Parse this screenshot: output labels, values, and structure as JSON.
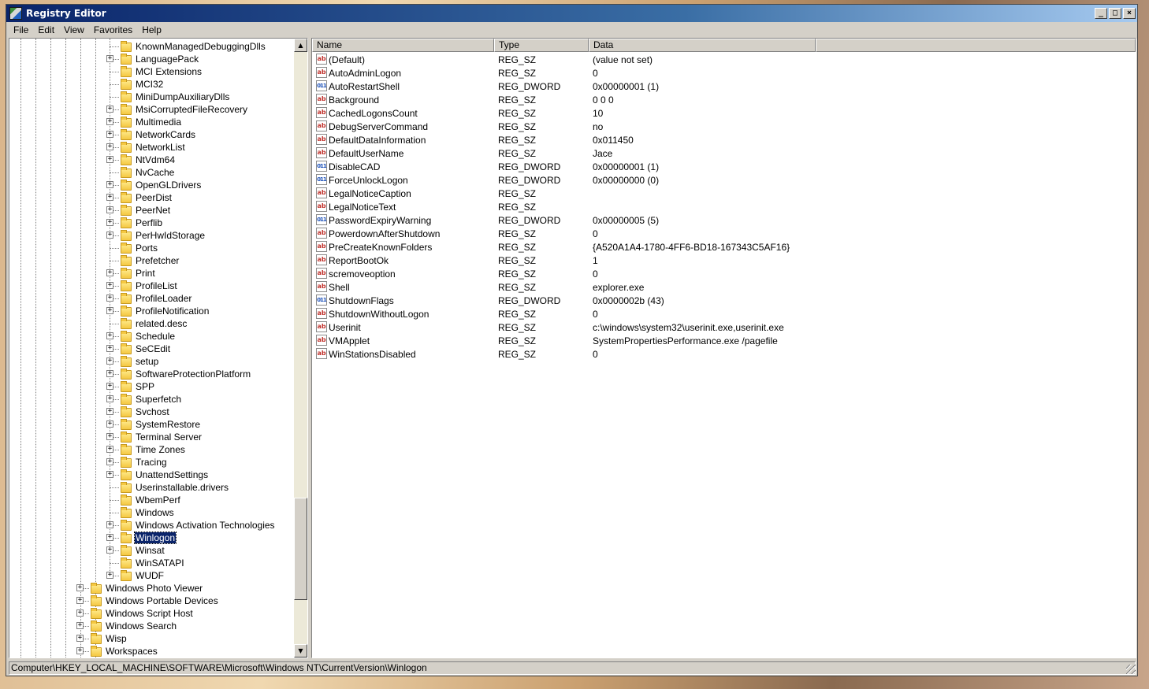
{
  "window": {
    "title": "Registry Editor",
    "controls": [
      "_",
      "□",
      "×"
    ]
  },
  "menu": [
    "File",
    "Edit",
    "View",
    "Favorites",
    "Help"
  ],
  "tree": {
    "nested_items": [
      {
        "label": "KnownManagedDebuggingDlls",
        "expandable": false
      },
      {
        "label": "LanguagePack",
        "expandable": true
      },
      {
        "label": "MCI Extensions",
        "expandable": false
      },
      {
        "label": "MCI32",
        "expandable": false
      },
      {
        "label": "MiniDumpAuxiliaryDlls",
        "expandable": false
      },
      {
        "label": "MsiCorruptedFileRecovery",
        "expandable": true
      },
      {
        "label": "Multimedia",
        "expandable": true
      },
      {
        "label": "NetworkCards",
        "expandable": true
      },
      {
        "label": "NetworkList",
        "expandable": true
      },
      {
        "label": "NtVdm64",
        "expandable": true
      },
      {
        "label": "NvCache",
        "expandable": false
      },
      {
        "label": "OpenGLDrivers",
        "expandable": true
      },
      {
        "label": "PeerDist",
        "expandable": true
      },
      {
        "label": "PeerNet",
        "expandable": true
      },
      {
        "label": "Perflib",
        "expandable": true
      },
      {
        "label": "PerHwIdStorage",
        "expandable": true
      },
      {
        "label": "Ports",
        "expandable": false
      },
      {
        "label": "Prefetcher",
        "expandable": false
      },
      {
        "label": "Print",
        "expandable": true
      },
      {
        "label": "ProfileList",
        "expandable": true
      },
      {
        "label": "ProfileLoader",
        "expandable": true
      },
      {
        "label": "ProfileNotification",
        "expandable": true
      },
      {
        "label": "related.desc",
        "expandable": false
      },
      {
        "label": "Schedule",
        "expandable": true
      },
      {
        "label": "SeCEdit",
        "expandable": true
      },
      {
        "label": "setup",
        "expandable": true
      },
      {
        "label": "SoftwareProtectionPlatform",
        "expandable": true
      },
      {
        "label": "SPP",
        "expandable": true
      },
      {
        "label": "Superfetch",
        "expandable": true
      },
      {
        "label": "Svchost",
        "expandable": true
      },
      {
        "label": "SystemRestore",
        "expandable": true
      },
      {
        "label": "Terminal Server",
        "expandable": true
      },
      {
        "label": "Time Zones",
        "expandable": true
      },
      {
        "label": "Tracing",
        "expandable": true
      },
      {
        "label": "UnattendSettings",
        "expandable": true
      },
      {
        "label": "Userinstallable.drivers",
        "expandable": false
      },
      {
        "label": "WbemPerf",
        "expandable": false
      },
      {
        "label": "Windows",
        "expandable": false
      },
      {
        "label": "Windows Activation Technologies",
        "expandable": true
      },
      {
        "label": "Winlogon",
        "expandable": true,
        "selected": true
      },
      {
        "label": "Winsat",
        "expandable": true
      },
      {
        "label": "WinSATAPI",
        "expandable": false
      },
      {
        "label": "WUDF",
        "expandable": true
      }
    ],
    "parent_items": [
      {
        "label": "Windows Photo Viewer",
        "expandable": true
      },
      {
        "label": "Windows Portable Devices",
        "expandable": true
      },
      {
        "label": "Windows Script Host",
        "expandable": true
      },
      {
        "label": "Windows Search",
        "expandable": true
      },
      {
        "label": "Wisp",
        "expandable": true
      },
      {
        "label": "Workspaces",
        "expandable": true
      }
    ]
  },
  "list": {
    "columns": [
      "Name",
      "Type",
      "Data"
    ],
    "rows": [
      {
        "icon": "string-value-icon",
        "name": "(Default)",
        "type": "REG_SZ",
        "data": "(value not set)"
      },
      {
        "icon": "string-value-icon",
        "name": "AutoAdminLogon",
        "type": "REG_SZ",
        "data": "0"
      },
      {
        "icon": "dword-value-icon",
        "name": "AutoRestartShell",
        "type": "REG_DWORD",
        "data": "0x00000001 (1)"
      },
      {
        "icon": "string-value-icon",
        "name": "Background",
        "type": "REG_SZ",
        "data": "0 0 0"
      },
      {
        "icon": "string-value-icon",
        "name": "CachedLogonsCount",
        "type": "REG_SZ",
        "data": "10"
      },
      {
        "icon": "string-value-icon",
        "name": "DebugServerCommand",
        "type": "REG_SZ",
        "data": "no"
      },
      {
        "icon": "string-value-icon",
        "name": "DefaultDataInformation",
        "type": "REG_SZ",
        "data": "0x011450"
      },
      {
        "icon": "string-value-icon",
        "name": "DefaultUserName",
        "type": "REG_SZ",
        "data": "Jace"
      },
      {
        "icon": "dword-value-icon",
        "name": "DisableCAD",
        "type": "REG_DWORD",
        "data": "0x00000001 (1)"
      },
      {
        "icon": "dword-value-icon",
        "name": "ForceUnlockLogon",
        "type": "REG_DWORD",
        "data": "0x00000000 (0)"
      },
      {
        "icon": "string-value-icon",
        "name": "LegalNoticeCaption",
        "type": "REG_SZ",
        "data": ""
      },
      {
        "icon": "string-value-icon",
        "name": "LegalNoticeText",
        "type": "REG_SZ",
        "data": ""
      },
      {
        "icon": "dword-value-icon",
        "name": "PasswordExpiryWarning",
        "type": "REG_DWORD",
        "data": "0x00000005 (5)"
      },
      {
        "icon": "string-value-icon",
        "name": "PowerdownAfterShutdown",
        "type": "REG_SZ",
        "data": "0"
      },
      {
        "icon": "string-value-icon",
        "name": "PreCreateKnownFolders",
        "type": "REG_SZ",
        "data": "{A520A1A4-1780-4FF6-BD18-167343C5AF16}"
      },
      {
        "icon": "string-value-icon",
        "name": "ReportBootOk",
        "type": "REG_SZ",
        "data": "1"
      },
      {
        "icon": "string-value-icon",
        "name": "scremoveoption",
        "type": "REG_SZ",
        "data": "0"
      },
      {
        "icon": "string-value-icon",
        "name": "Shell",
        "type": "REG_SZ",
        "data": "explorer.exe"
      },
      {
        "icon": "dword-value-icon",
        "name": "ShutdownFlags",
        "type": "REG_DWORD",
        "data": "0x0000002b (43)"
      },
      {
        "icon": "string-value-icon",
        "name": "ShutdownWithoutLogon",
        "type": "REG_SZ",
        "data": "0"
      },
      {
        "icon": "string-value-icon",
        "name": "Userinit",
        "type": "REG_SZ",
        "data": "c:\\windows\\system32\\userinit.exe,userinit.exe"
      },
      {
        "icon": "string-value-icon",
        "name": "VMApplet",
        "type": "REG_SZ",
        "data": "SystemPropertiesPerformance.exe /pagefile"
      },
      {
        "icon": "string-value-icon",
        "name": "WinStationsDisabled",
        "type": "REG_SZ",
        "data": "0"
      }
    ]
  },
  "status": {
    "path": "Computer\\HKEY_LOCAL_MACHINE\\SOFTWARE\\Microsoft\\Windows NT\\CurrentVersion\\Winlogon"
  },
  "icon_glyphs": {
    "sz": "ab",
    "dword": "011"
  },
  "colors": {
    "title_start": "#0a246a",
    "selection": "#0a246a",
    "chrome": "#d4d0c8"
  }
}
